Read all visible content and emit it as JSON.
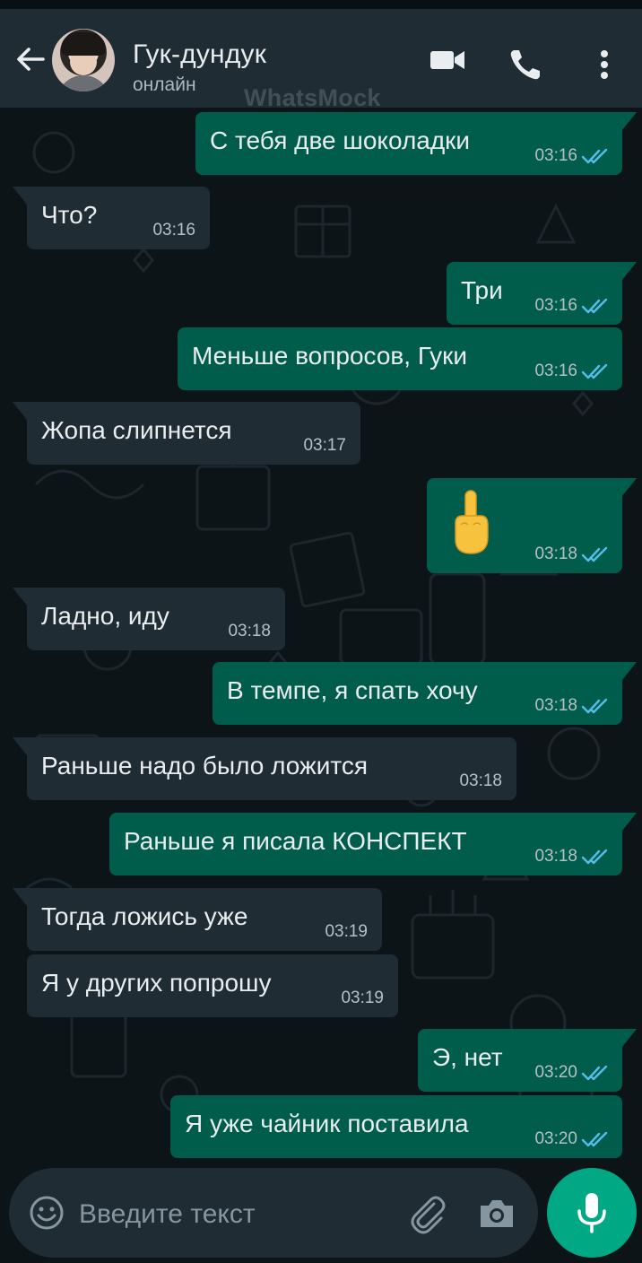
{
  "contact": {
    "name": "Гук-дундук",
    "status": "онлайн"
  },
  "watermark": "WhatsMock",
  "icons": {
    "back": "arrow-left-icon",
    "video": "video-camera-icon",
    "call": "phone-icon",
    "menu": "more-vertical-icon",
    "emoji": "smile-icon",
    "attach": "paperclip-icon",
    "camera": "camera-icon",
    "mic": "microphone-icon",
    "read": "double-check-icon"
  },
  "colors": {
    "header": "#1f2c34",
    "background": "#0d1418",
    "incoming_bubble": "#1f2c34",
    "outgoing_bubble": "#005c4b",
    "read_ticks": "#53bdeb",
    "mic_button": "#00a884"
  },
  "messages": [
    {
      "dir": "out",
      "text": "С тебя две шоколадки",
      "time": "03:16",
      "read": true
    },
    {
      "dir": "in",
      "text": "Что?",
      "time": "03:16"
    },
    {
      "dir": "out",
      "text": "Три",
      "time": "03:16",
      "read": true
    },
    {
      "dir": "out",
      "text": "Меньше вопросов, Гуки",
      "time": "03:16",
      "read": true
    },
    {
      "dir": "in",
      "text": "Жопа слипнется",
      "time": "03:17"
    },
    {
      "dir": "out",
      "text": "🖕",
      "emoji": "middle-finger-emoji",
      "time": "03:18",
      "read": true
    },
    {
      "dir": "in",
      "text": "Ладно, иду",
      "time": "03:18"
    },
    {
      "dir": "out",
      "text": "В темпе, я спать хочу",
      "time": "03:18",
      "read": true
    },
    {
      "dir": "in",
      "text": "Раньше надо было ложится",
      "time": "03:18"
    },
    {
      "dir": "out",
      "text": "Раньше я писала КОНСПЕКТ",
      "time": "03:18",
      "read": true
    },
    {
      "dir": "in",
      "text": "Тогда ложись уже",
      "time": "03:19"
    },
    {
      "dir": "in",
      "text": "Я у других попрошу",
      "time": "03:19"
    },
    {
      "dir": "out",
      "text": "Э, нет",
      "time": "03:20",
      "read": true
    },
    {
      "dir": "out",
      "text": "Я уже чайник поставила",
      "time": "03:20",
      "read": true
    }
  ],
  "composer": {
    "placeholder": "Введите текст"
  }
}
